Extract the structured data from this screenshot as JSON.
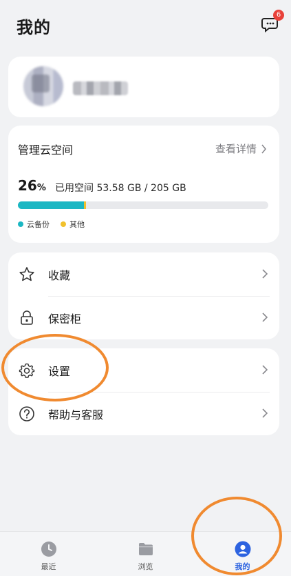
{
  "header": {
    "title": "我的",
    "message_badge": "6"
  },
  "storage": {
    "title": "管理云空间",
    "detail_link": "查看详情",
    "percent_value": "26",
    "percent_sign": "%",
    "used_text": "已用空间 53.58 GB / 205 GB",
    "backup_fraction": 0.265,
    "other_fraction": 0.008,
    "legend": [
      {
        "label": "云备份",
        "color": "#1bb7c3"
      },
      {
        "label": "其他",
        "color": "#f1c12c"
      }
    ]
  },
  "menu": {
    "favorites": "收藏",
    "safe": "保密柜",
    "settings": "设置",
    "help": "帮助与客服"
  },
  "tabs": [
    {
      "label": "最近",
      "icon": "clock-icon"
    },
    {
      "label": "浏览",
      "icon": "folder-icon"
    },
    {
      "label": "我的",
      "icon": "user-icon"
    }
  ],
  "colors": {
    "accent": "#2d63e0",
    "annotation": "#f08a30",
    "background": "#f1f2f4"
  }
}
